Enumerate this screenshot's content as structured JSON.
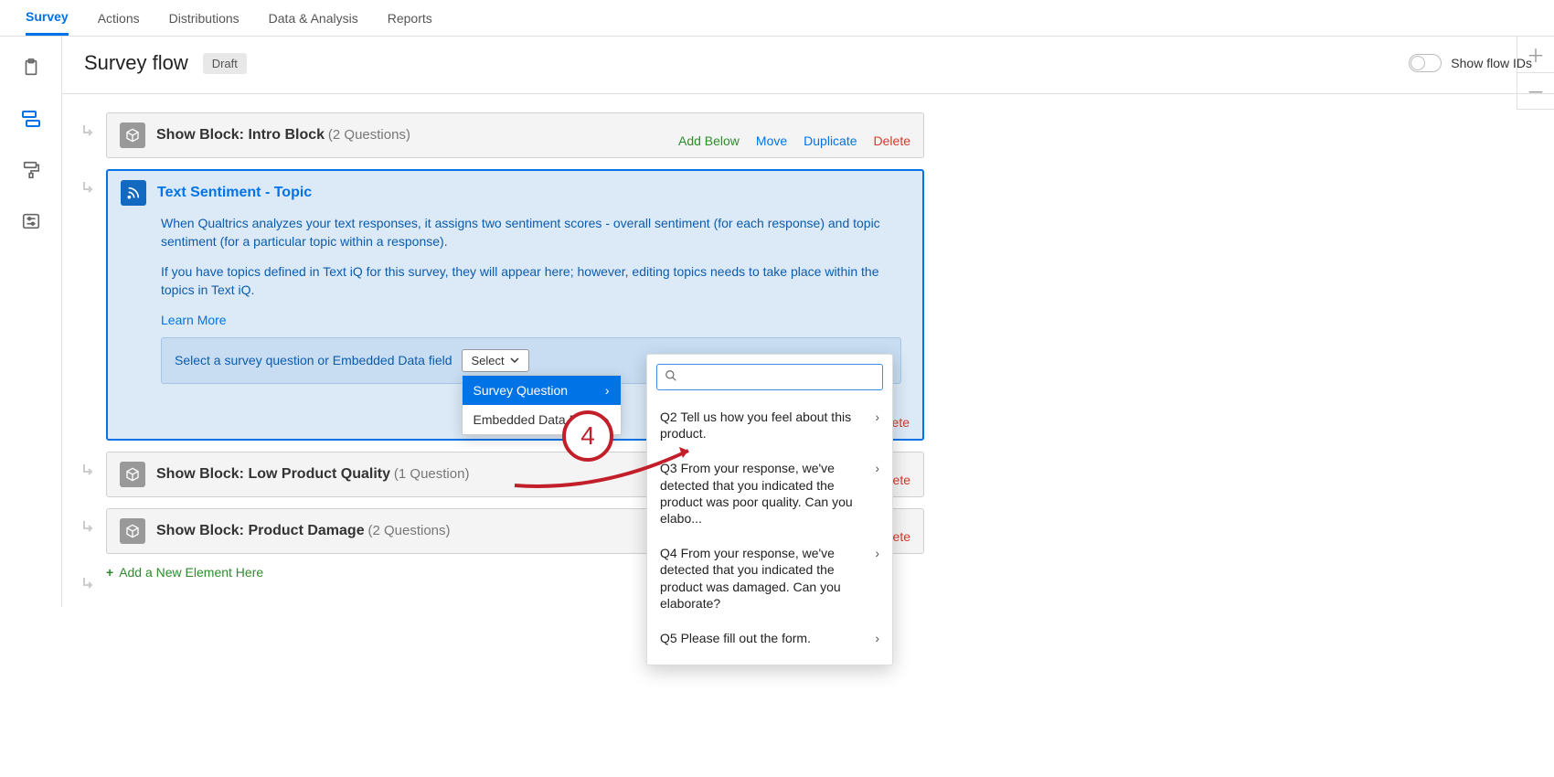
{
  "tabs": {
    "survey": "Survey",
    "actions": "Actions",
    "distributions": "Distributions",
    "data": "Data & Analysis",
    "reports": "Reports"
  },
  "header": {
    "title": "Survey flow",
    "badge": "Draft",
    "showFlowIds": "Show flow IDs"
  },
  "zoom": {
    "plus": "＋",
    "minus": "－"
  },
  "blocks": {
    "intro": {
      "title": "Show Block: Intro Block",
      "count": "(2 Questions)"
    },
    "sentiment": {
      "title": "Text Sentiment - Topic",
      "desc1": "When Qualtrics analyzes your text responses, it assigns two sentiment scores - overall sentiment (for each response) and topic sentiment (for a particular topic within a response).",
      "desc2": "If you have topics defined in Text iQ for this survey, they will appear here; however, editing topics needs to take place within the topics in Text iQ.",
      "learnMore": "Learn More",
      "innerLabel": "Select a survey question or Embedded Data field",
      "selectLabel": "Select"
    },
    "lowQuality": {
      "title": "Show Block: Low Product Quality",
      "count": "(1 Question)"
    },
    "damage": {
      "title": "Show Block: Product Damage",
      "count": "(2 Questions)"
    }
  },
  "actions": {
    "addBelow": "Add Below",
    "move": "Move",
    "duplicate": "Duplicate",
    "delete": "Delete"
  },
  "dropdown": {
    "surveyQuestion": "Survey Question",
    "embeddedData": "Embedded Data Field"
  },
  "submenuItems": [
    "Q2 Tell us how you feel about this product.",
    "Q3 From your response, we've detected that you indicated the product was poor quality. Can you elabo...",
    "Q4 From your response, we've detected that you indicated the product was damaged. Can you elaborate?",
    "Q5 Please fill out the form."
  ],
  "addElement": "Add a New Element Here",
  "annotation": {
    "number": "4"
  }
}
